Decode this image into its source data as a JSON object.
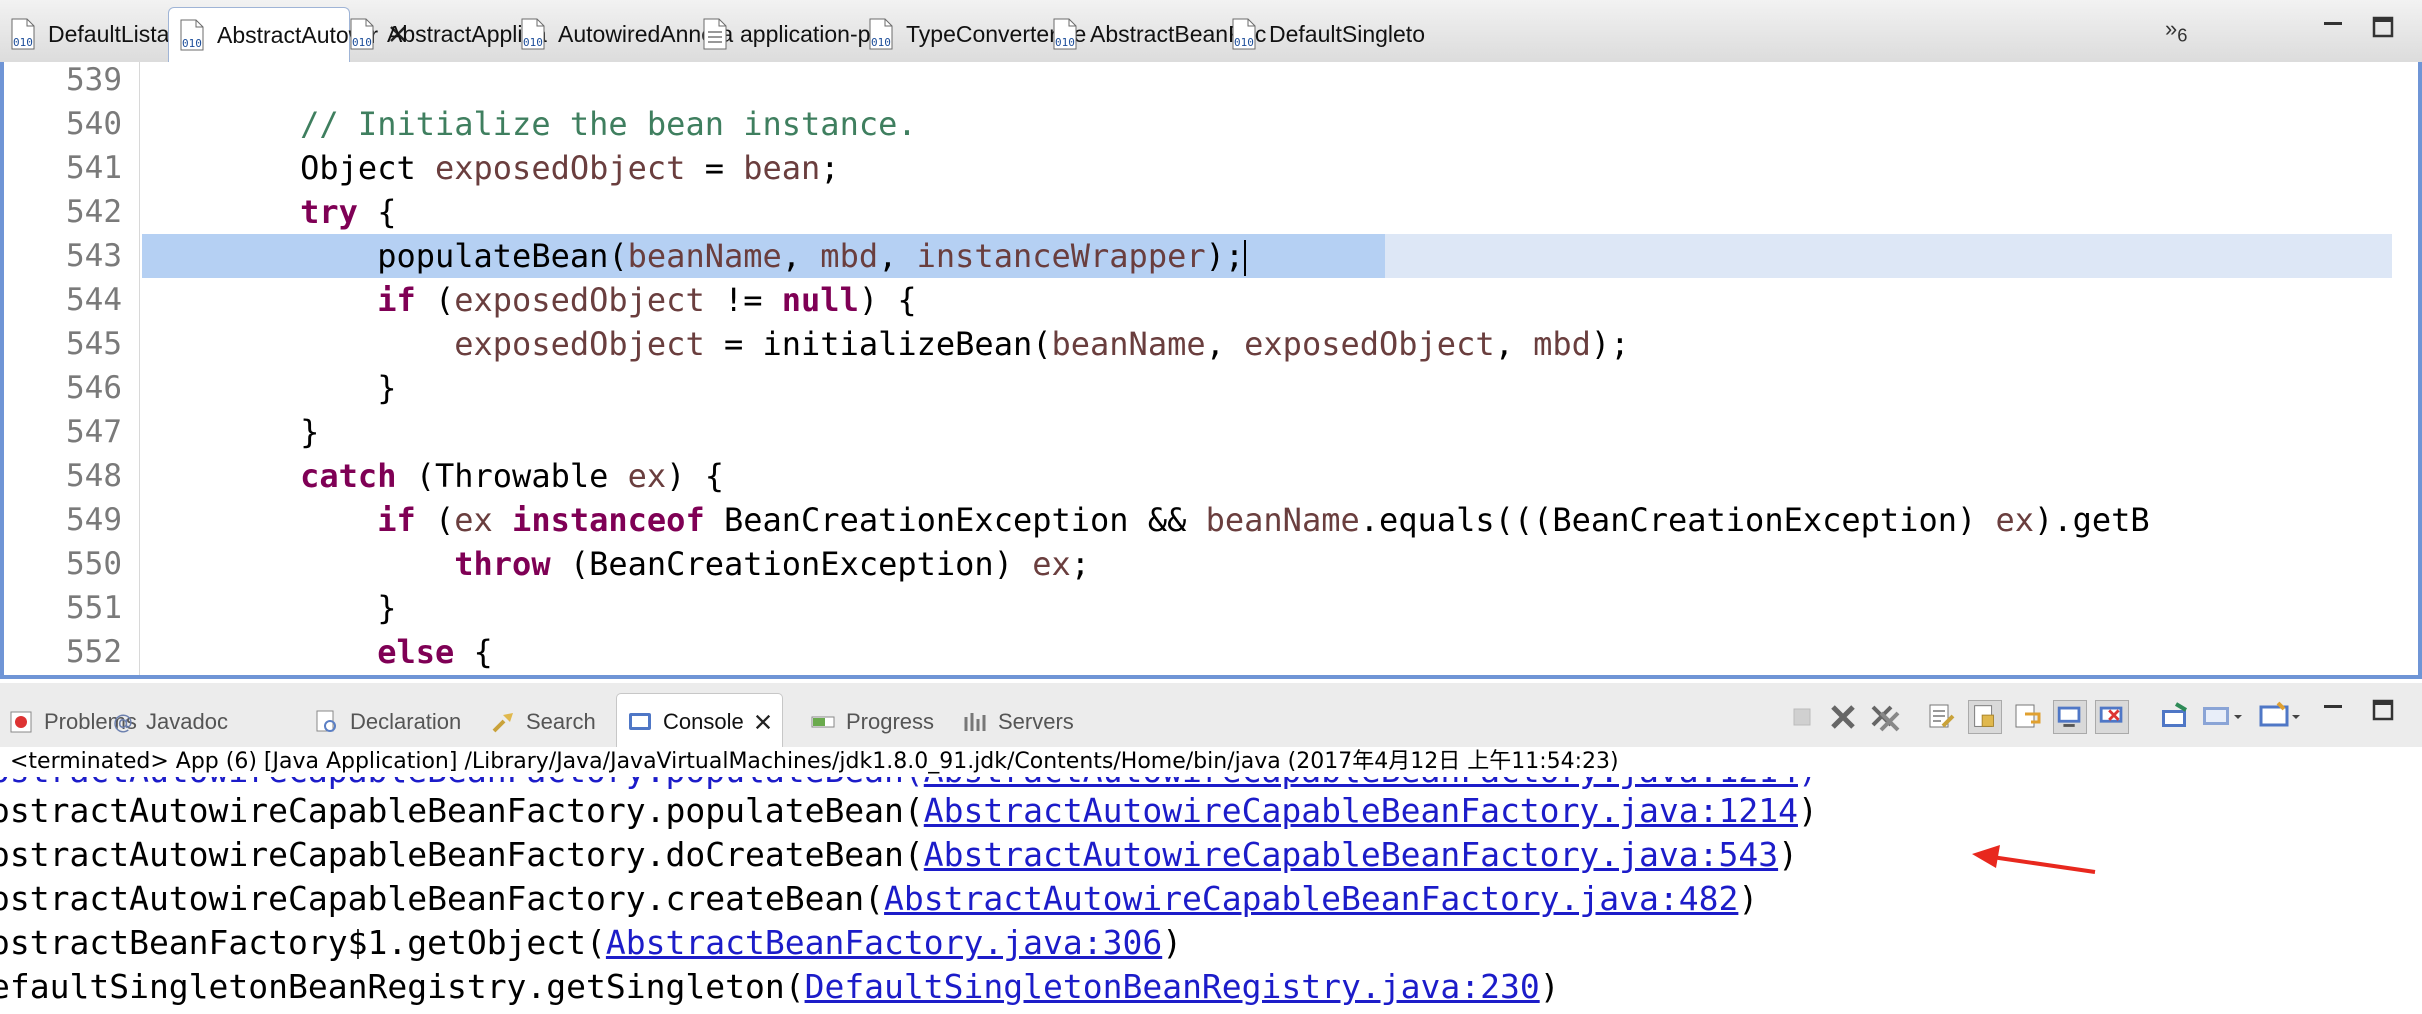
{
  "editor_tabs": [
    {
      "label": "DefaultListable",
      "icon": "java-class-file-icon"
    },
    {
      "label": "AbstractAutowir",
      "icon": "java-class-file-icon",
      "active": true,
      "closable": true
    },
    {
      "label": "AbstractApplica",
      "icon": "java-class-file-icon"
    },
    {
      "label": "AutowiredAnnota",
      "icon": "java-class-file-icon"
    },
    {
      "label": "application-pro",
      "icon": "properties-file-icon"
    },
    {
      "label": "TypeConverterDe",
      "icon": "java-class-file-icon"
    },
    {
      "label": "AbstractBeanFac",
      "icon": "java-class-file-icon"
    },
    {
      "label": "DefaultSingleto",
      "icon": "java-class-file-icon"
    }
  ],
  "tabs_overflow": {
    "symbol": "»",
    "count": "6"
  },
  "code_lines": [
    {
      "num": "539",
      "text": ""
    },
    {
      "num": "540",
      "text": "        // Initialize the bean instance."
    },
    {
      "num": "541",
      "text": "        Object exposedObject = bean;"
    },
    {
      "num": "542",
      "text": "        try {"
    },
    {
      "num": "543",
      "text": "            populateBean(beanName, mbd, instanceWrapper);"
    },
    {
      "num": "544",
      "text": "            if (exposedObject != null) {"
    },
    {
      "num": "545",
      "text": "                exposedObject = initializeBean(beanName, exposedObject, mbd);"
    },
    {
      "num": "546",
      "text": "            }"
    },
    {
      "num": "547",
      "text": "        }"
    },
    {
      "num": "548",
      "text": "        catch (Throwable ex) {"
    },
    {
      "num": "549",
      "text": "            if (ex instanceof BeanCreationException && beanName.equals(((BeanCreationException) ex).getB"
    },
    {
      "num": "550",
      "text": "                throw (BeanCreationException) ex;"
    },
    {
      "num": "551",
      "text": "            }"
    },
    {
      "num": "552",
      "text": "            else {"
    }
  ],
  "current_line": "543",
  "view_tabs": [
    {
      "label": "Problems",
      "icon": "problems-icon"
    },
    {
      "label": "Javadoc",
      "icon": "javadoc-at-icon"
    },
    {
      "label": "Declaration",
      "icon": "declaration-icon"
    },
    {
      "label": "Search",
      "icon": "search-flashlight-icon"
    },
    {
      "label": "Console",
      "icon": "console-icon",
      "active": true,
      "closable": true
    },
    {
      "label": "Progress",
      "icon": "progress-icon"
    },
    {
      "label": "Servers",
      "icon": "servers-icon"
    }
  ],
  "console": {
    "status": "<terminated> App (6) [Java Application] /Library/Java/JavaVirtualMachines/jdk1.8.0_91.jdk/Contents/Home/bin/java (2017年4月12日 上午11:54:23)",
    "lines": [
      {
        "prefix": "ostractAutowireCapableBeanFactory.populateBean(",
        "link": "AbstractAutowireCapableBeanFactory.java:1214",
        "suffix": ")"
      },
      {
        "prefix": "ostractAutowireCapableBeanFactory.doCreateBean(",
        "link": "AbstractAutowireCapableBeanFactory.java:543",
        "suffix": ")"
      },
      {
        "prefix": "ostractAutowireCapableBeanFactory.createBean(",
        "link": "AbstractAutowireCapableBeanFactory.java:482",
        "suffix": ")"
      },
      {
        "prefix": "ostractBeanFactory$1.getObject(",
        "link": "AbstractBeanFactory.java:306",
        "suffix": ")"
      },
      {
        "prefix": "efaultSingletonBeanRegistry.getSingleton(",
        "link": "DefaultSingletonBeanRegistry.java:230",
        "suffix": ")"
      }
    ]
  },
  "colors": {
    "keyword": "#7f0055",
    "comment": "#3f7f5f",
    "variable": "#6a3e3e",
    "link": "#1c1cc9",
    "arrow": "#e8281e",
    "current_line": "#dde7f6"
  }
}
